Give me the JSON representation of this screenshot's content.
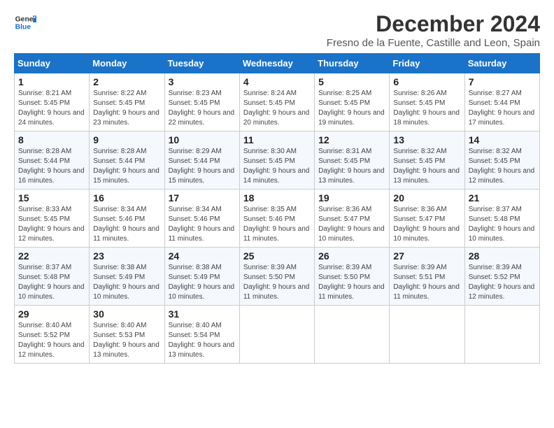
{
  "logo": {
    "line1": "General",
    "line2": "Blue"
  },
  "title": "December 2024",
  "subtitle": "Fresno de la Fuente, Castille and Leon, Spain",
  "headers": [
    "Sunday",
    "Monday",
    "Tuesday",
    "Wednesday",
    "Thursday",
    "Friday",
    "Saturday"
  ],
  "weeks": [
    [
      {
        "day": "1",
        "sunrise": "8:21 AM",
        "sunset": "5:45 PM",
        "daylight": "9 hours and 24 minutes."
      },
      {
        "day": "2",
        "sunrise": "8:22 AM",
        "sunset": "5:45 PM",
        "daylight": "9 hours and 23 minutes."
      },
      {
        "day": "3",
        "sunrise": "8:23 AM",
        "sunset": "5:45 PM",
        "daylight": "9 hours and 22 minutes."
      },
      {
        "day": "4",
        "sunrise": "8:24 AM",
        "sunset": "5:45 PM",
        "daylight": "9 hours and 20 minutes."
      },
      {
        "day": "5",
        "sunrise": "8:25 AM",
        "sunset": "5:45 PM",
        "daylight": "9 hours and 19 minutes."
      },
      {
        "day": "6",
        "sunrise": "8:26 AM",
        "sunset": "5:45 PM",
        "daylight": "9 hours and 18 minutes."
      },
      {
        "day": "7",
        "sunrise": "8:27 AM",
        "sunset": "5:44 PM",
        "daylight": "9 hours and 17 minutes."
      }
    ],
    [
      {
        "day": "8",
        "sunrise": "8:28 AM",
        "sunset": "5:44 PM",
        "daylight": "9 hours and 16 minutes."
      },
      {
        "day": "9",
        "sunrise": "8:28 AM",
        "sunset": "5:44 PM",
        "daylight": "9 hours and 15 minutes."
      },
      {
        "day": "10",
        "sunrise": "8:29 AM",
        "sunset": "5:44 PM",
        "daylight": "9 hours and 15 minutes."
      },
      {
        "day": "11",
        "sunrise": "8:30 AM",
        "sunset": "5:45 PM",
        "daylight": "9 hours and 14 minutes."
      },
      {
        "day": "12",
        "sunrise": "8:31 AM",
        "sunset": "5:45 PM",
        "daylight": "9 hours and 13 minutes."
      },
      {
        "day": "13",
        "sunrise": "8:32 AM",
        "sunset": "5:45 PM",
        "daylight": "9 hours and 13 minutes."
      },
      {
        "day": "14",
        "sunrise": "8:32 AM",
        "sunset": "5:45 PM",
        "daylight": "9 hours and 12 minutes."
      }
    ],
    [
      {
        "day": "15",
        "sunrise": "8:33 AM",
        "sunset": "5:45 PM",
        "daylight": "9 hours and 12 minutes."
      },
      {
        "day": "16",
        "sunrise": "8:34 AM",
        "sunset": "5:46 PM",
        "daylight": "9 hours and 11 minutes."
      },
      {
        "day": "17",
        "sunrise": "8:34 AM",
        "sunset": "5:46 PM",
        "daylight": "9 hours and 11 minutes."
      },
      {
        "day": "18",
        "sunrise": "8:35 AM",
        "sunset": "5:46 PM",
        "daylight": "9 hours and 11 minutes."
      },
      {
        "day": "19",
        "sunrise": "8:36 AM",
        "sunset": "5:47 PM",
        "daylight": "9 hours and 10 minutes."
      },
      {
        "day": "20",
        "sunrise": "8:36 AM",
        "sunset": "5:47 PM",
        "daylight": "9 hours and 10 minutes."
      },
      {
        "day": "21",
        "sunrise": "8:37 AM",
        "sunset": "5:48 PM",
        "daylight": "9 hours and 10 minutes."
      }
    ],
    [
      {
        "day": "22",
        "sunrise": "8:37 AM",
        "sunset": "5:48 PM",
        "daylight": "9 hours and 10 minutes."
      },
      {
        "day": "23",
        "sunrise": "8:38 AM",
        "sunset": "5:49 PM",
        "daylight": "9 hours and 10 minutes."
      },
      {
        "day": "24",
        "sunrise": "8:38 AM",
        "sunset": "5:49 PM",
        "daylight": "9 hours and 10 minutes."
      },
      {
        "day": "25",
        "sunrise": "8:39 AM",
        "sunset": "5:50 PM",
        "daylight": "9 hours and 11 minutes."
      },
      {
        "day": "26",
        "sunrise": "8:39 AM",
        "sunset": "5:50 PM",
        "daylight": "9 hours and 11 minutes."
      },
      {
        "day": "27",
        "sunrise": "8:39 AM",
        "sunset": "5:51 PM",
        "daylight": "9 hours and 11 minutes."
      },
      {
        "day": "28",
        "sunrise": "8:39 AM",
        "sunset": "5:52 PM",
        "daylight": "9 hours and 12 minutes."
      }
    ],
    [
      {
        "day": "29",
        "sunrise": "8:40 AM",
        "sunset": "5:52 PM",
        "daylight": "9 hours and 12 minutes."
      },
      {
        "day": "30",
        "sunrise": "8:40 AM",
        "sunset": "5:53 PM",
        "daylight": "9 hours and 13 minutes."
      },
      {
        "day": "31",
        "sunrise": "8:40 AM",
        "sunset": "5:54 PM",
        "daylight": "9 hours and 13 minutes."
      },
      null,
      null,
      null,
      null
    ]
  ]
}
